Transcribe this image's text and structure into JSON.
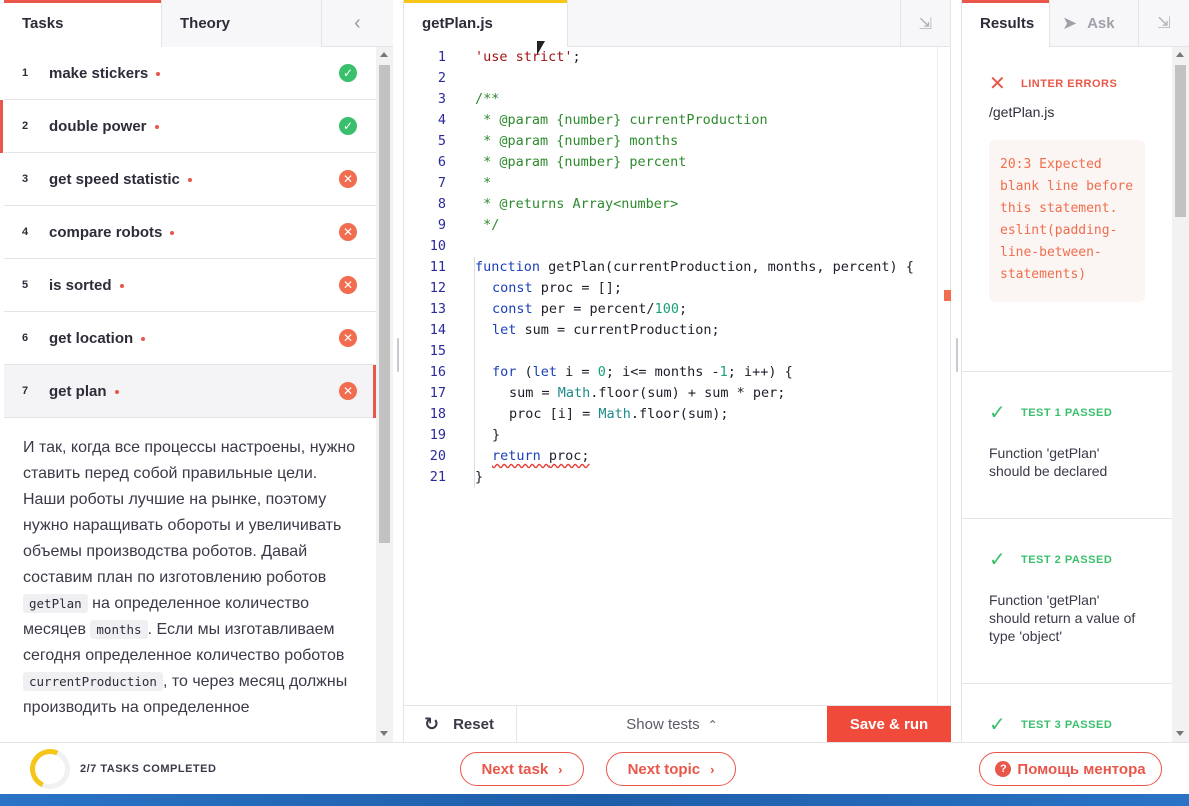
{
  "left_panel": {
    "tabs": [
      {
        "label": "Tasks"
      },
      {
        "label": "Theory"
      }
    ],
    "tasks": [
      {
        "num": "1",
        "title": "make stickers",
        "status": "passed"
      },
      {
        "num": "2",
        "title": "double power",
        "status": "passed"
      },
      {
        "num": "3",
        "title": "get speed statistic",
        "status": "failed"
      },
      {
        "num": "4",
        "title": "compare robots",
        "status": "failed"
      },
      {
        "num": "5",
        "title": "is sorted",
        "status": "failed"
      },
      {
        "num": "6",
        "title": "get location",
        "status": "failed"
      },
      {
        "num": "7",
        "title": "get plan",
        "status": "failed"
      }
    ],
    "description": {
      "p1": "И так, когда все процессы настроены, нужно ставить перед собой правильные цели. Наши роботы лучшие на рынке, поэтому нужно наращивать обороты и увеличивать объемы производства роботов. Давай составим план по изготовлению роботов",
      "code1": "getPlan",
      "p2": "на определенное количество месяцев",
      "code2": "months",
      "p3": ". Если мы изготавливаем сегодня определенное количество роботов",
      "code3": "currentProduction",
      "p4": ", то через месяц должны производить на определенное"
    }
  },
  "editor": {
    "filename": "getPlan.js",
    "lines": [
      {
        "n": "1"
      },
      {
        "n": "2"
      },
      {
        "n": "3"
      },
      {
        "n": "4"
      },
      {
        "n": "5"
      },
      {
        "n": "6"
      },
      {
        "n": "7"
      },
      {
        "n": "8"
      },
      {
        "n": "9"
      },
      {
        "n": "10"
      },
      {
        "n": "11"
      },
      {
        "n": "12"
      },
      {
        "n": "13"
      },
      {
        "n": "14"
      },
      {
        "n": "15"
      },
      {
        "n": "16"
      },
      {
        "n": "17"
      },
      {
        "n": "18"
      },
      {
        "n": "19"
      },
      {
        "n": "20"
      },
      {
        "n": "21"
      }
    ],
    "code": {
      "l1": "'use strict'",
      "l1_end": ";",
      "l3": "/**",
      "l4": " * @param {number} currentProduction",
      "l5": " * @param {number} months",
      "l6": " * @param {number} percent",
      "l7": " *",
      "l8": " * @returns Array<number>",
      "l9": " */",
      "l11_kw": "function",
      "l11_rest": " getPlan(currentProduction, months, percent) {",
      "l12_kw": "const",
      "l12_rest": " proc = [];",
      "l13_kw": "const",
      "l13_a": " per = percent/",
      "l13_num": "100",
      "l13_end": ";",
      "l14_kw": "let",
      "l14_rest": " sum = currentProduction;",
      "l16_kw": "for",
      "l16_a": " (",
      "l16_kw2": "let",
      "l16_b": " i = ",
      "l16_n0": "0",
      "l16_c": "; i<= months -",
      "l16_n1": "1",
      "l16_d": "; i++) {",
      "l17_a": "sum = ",
      "l17_t": "Math",
      "l17_b": ".floor(sum) + sum * per;",
      "l18_a": "proc [i] = ",
      "l18_t": "Math",
      "l18_b": ".floor(sum);",
      "l19": "}",
      "l20_kw": "return",
      "l20_rest": "proc;",
      "l21": "}"
    },
    "footer": {
      "reset_label": "Reset",
      "show_tests_label": "Show tests",
      "run_label": "Save & run"
    }
  },
  "results": {
    "tabs": {
      "results": "Results",
      "ask": "Ask"
    },
    "linter": {
      "title": "LINTER ERRORS",
      "path": "/getPlan.js",
      "message": "20:3  Expected blank line before this statement. eslint(padding-line-between-statements)"
    },
    "tests": [
      {
        "title": "TEST 1 PASSED",
        "text": "Function 'getPlan' should be declared"
      },
      {
        "title": "TEST 2 PASSED",
        "text": "Function 'getPlan' should return a value of type 'object'"
      },
      {
        "title": "TEST 3 PASSED",
        "text": ""
      }
    ]
  },
  "footer": {
    "progress_label": "2/7 TASKS COMPLETED",
    "progress_done": 2,
    "progress_total": 7,
    "next_task_label": "Next task",
    "next_topic_label": "Next topic",
    "mentor_label": "Помощь ментора"
  },
  "colors": {
    "accent": "#e9574a",
    "run_button": "#f04a3a",
    "passed": "#3ac06d",
    "failed": "#f26c4f",
    "editor_tab_indicator": "#f5c518"
  }
}
